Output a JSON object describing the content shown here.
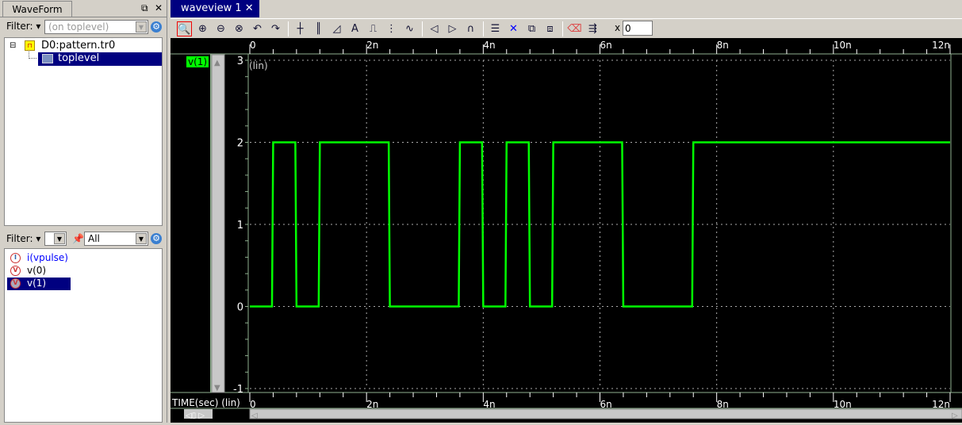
{
  "left_panel": {
    "tab_label": "WaveForm",
    "filter_label": "Filter:",
    "filter_placeholder": "(on toplevel)",
    "tree": [
      {
        "label": "D0:pattern.tr0"
      },
      {
        "label": "toplevel",
        "selected": true
      }
    ],
    "signal_filter_label": "Filter:",
    "signal_filter_value": "",
    "signal_scope_value": "All",
    "signals": [
      {
        "label": "i(vpulse)",
        "type": "current",
        "color": "#0000ff"
      },
      {
        "label": "v(0)",
        "type": "voltage",
        "color": "#000000"
      },
      {
        "label": "v(1)",
        "type": "voltage",
        "color": "#ffffff",
        "selected": true
      }
    ]
  },
  "view": {
    "tab_label": "waveview 1",
    "toolbar": {
      "icons": [
        "zoom-fit-icon",
        "zoom-in-icon",
        "zoom-out-icon",
        "zoom-full-icon",
        "zoom-back-icon",
        "zoom-forward-icon",
        "cursor-icon",
        "bus-icon",
        "measure-icon",
        "annotate-icon",
        "digital-icon",
        "grid-icon",
        "analog-icon",
        "prev-edge-icon",
        "next-edge-icon",
        "eye-icon",
        "stack-icon",
        "delete-icon",
        "split-icon",
        "merge-icon",
        "eraser-icon",
        "export-icon"
      ],
      "x_label": "x",
      "x_value": "0"
    },
    "signal_label": "v(1)",
    "signal_label_bg": "#00ff00",
    "y_scale_label": "(lin)",
    "x_axis_label": "TIME(sec) (lin)"
  },
  "chart_data": {
    "type": "line",
    "xlabel": "TIME(sec) (lin)",
    "ylabel": "",
    "xlim": [
      0,
      12
    ],
    "ylim": [
      -1,
      3
    ],
    "x_unit": "n",
    "x_ticks": [
      "0",
      "2n",
      "4n",
      "6n",
      "8n",
      "10n",
      "12n"
    ],
    "y_ticks": [
      "3",
      "2",
      "1",
      "0",
      "-1"
    ],
    "grid": true,
    "series": [
      {
        "name": "v(1)",
        "color": "#00ff00",
        "x": [
          0,
          0.38,
          0.4,
          0.78,
          0.8,
          1.18,
          1.2,
          2.38,
          2.4,
          3.58,
          3.6,
          3.98,
          4.0,
          4.38,
          4.4,
          4.78,
          4.8,
          5.18,
          5.2,
          6.38,
          6.4,
          7.58,
          7.6,
          12
        ],
        "y": [
          0,
          0,
          2,
          2,
          0,
          0,
          2,
          2,
          0,
          0,
          2,
          2,
          0,
          0,
          2,
          2,
          0,
          0,
          2,
          2,
          0,
          0,
          2,
          2
        ]
      }
    ]
  }
}
